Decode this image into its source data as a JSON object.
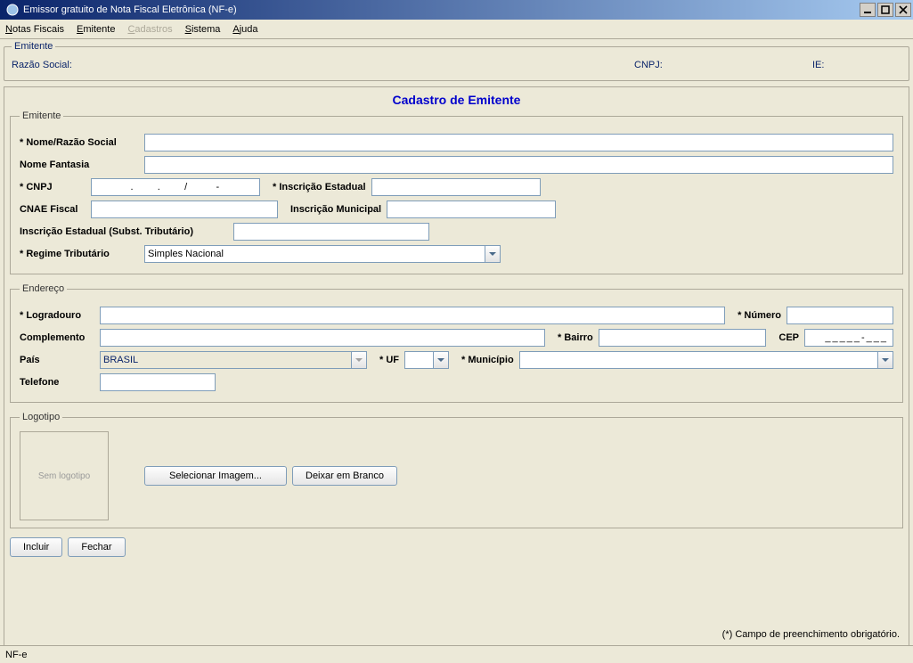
{
  "window": {
    "title": "Emissor gratuito de Nota Fiscal Eletrônica (NF-e)"
  },
  "menubar": {
    "notas_fiscais": "Notas Fiscais",
    "emitente": "Emitente",
    "cadastros": "Cadastros",
    "sistema": "Sistema",
    "ajuda": "Ajuda"
  },
  "header": {
    "group_title": "Emitente",
    "razao_social_label": "Razão Social:",
    "razao_social_value": "",
    "cnpj_label": "CNPJ:",
    "cnpj_value": "",
    "ie_label": "IE:",
    "ie_value": ""
  },
  "page": {
    "title": "Cadastro de Emitente",
    "emitente": {
      "group_title": "Emitente",
      "nome_label": "* Nome/Razão Social",
      "nome_value": "",
      "fantasia_label": "Nome Fantasia",
      "fantasia_value": "",
      "cnpj_label": "* CNPJ",
      "cnpj_value": "",
      "cnpj_mask": "      .   .   /    -  ",
      "ie_label": "* Inscrição Estadual",
      "ie_value": "",
      "cnae_label": "CNAE Fiscal",
      "cnae_value": "",
      "im_label": "Inscrição Municipal",
      "im_value": "",
      "ie_st_label": "Inscrição Estadual (Subst. Tributário)",
      "ie_st_value": "",
      "regime_label": "* Regime Tributário",
      "regime_value": "Simples Nacional"
    },
    "endereco": {
      "group_title": "Endereço",
      "logradouro_label": "* Logradouro",
      "logradouro_value": "",
      "numero_label": "* Número",
      "numero_value": "",
      "complemento_label": "Complemento",
      "complemento_value": "",
      "bairro_label": "* Bairro",
      "bairro_value": "",
      "cep_label": "CEP",
      "cep_value": "",
      "cep_mask": "_____-___",
      "pais_label": "País",
      "pais_value": "BRASIL",
      "uf_label": "* UF",
      "uf_value": "",
      "municipio_label": "* Município",
      "municipio_value": "",
      "telefone_label": "Telefone",
      "telefone_value": ""
    },
    "logotipo": {
      "group_title": "Logotipo",
      "placeholder": "Sem logotipo",
      "select_btn": "Selecionar Imagem...",
      "blank_btn": "Deixar em Branco"
    },
    "buttons": {
      "incluir": "Incluir",
      "fechar": "Fechar"
    },
    "footer_note": "(*) Campo de preenchimento obrigatório."
  },
  "statusbar": "NF-e"
}
